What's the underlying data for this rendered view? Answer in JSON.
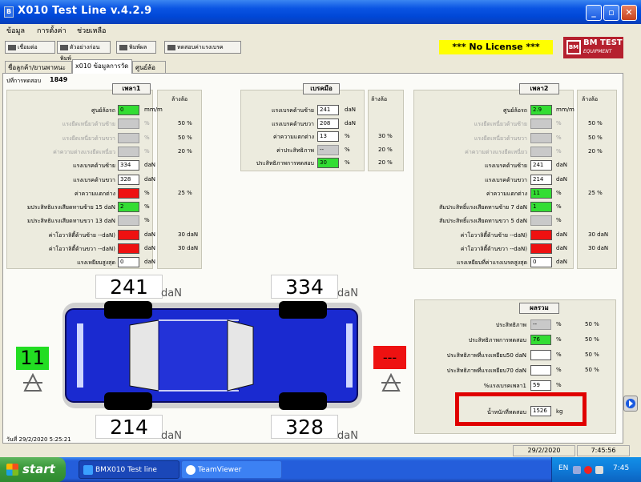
{
  "window": {
    "title": "X010 Test Line v.4.2.9",
    "app_icon": "B"
  },
  "menu": [
    "ข้อมูล",
    "การตั้งค่า",
    "ช่วยเหลือ"
  ],
  "toolbar": {
    "btn1": "เชื่อมต่อ",
    "btn2": "ตัวอย่างก่อนพิมพ์",
    "btn3": "พิมพ์ผล",
    "btn4": "ทดสอบค่าแรงเบรค"
  },
  "license": "***   No License ***",
  "logo": {
    "line1": "BM TEST",
    "line2": "EQUIPMENT",
    "mark": "BM"
  },
  "tabs": [
    "ชื่อลูกค้า/ยานพาหนะ",
    "x010 ข้อมูลการวัด",
    "ศูนย์ล้อรถ"
  ],
  "test_no": {
    "label": "ปที่การทดสอบ",
    "value": "1849"
  },
  "axle1": {
    "title": "เพลา1",
    "side": "ล้างล้อ",
    "rows": [
      {
        "label": "ศูนย์ล้อรถ",
        "value": "0",
        "unit": "mm/m",
        "style": "green",
        "dim": false,
        "extra": ""
      },
      {
        "label": "แรงยืดเหนี่ยวด้านซ้าย",
        "value": "",
        "unit": "%",
        "style": "gray",
        "dim": true,
        "extra": "50 %"
      },
      {
        "label": "แรงยืดเหนี่ยวด้านขวา",
        "value": "",
        "unit": "%",
        "style": "gray",
        "dim": true,
        "extra": "50 %"
      },
      {
        "label": "ค่าความต่างแรงยืดเหนี่ยว",
        "value": "",
        "unit": "%",
        "style": "gray",
        "dim": true,
        "extra": "20 %"
      },
      {
        "label": "แรงเบรคด้านซ้าย",
        "value": "334",
        "unit": "daN",
        "style": "white",
        "dim": false,
        "extra": ""
      },
      {
        "label": "แรงเบรคด้านขวา",
        "value": "328",
        "unit": "daN",
        "style": "white",
        "dim": false,
        "extra": ""
      },
      {
        "label": "ค่าความแตกต่าง",
        "value": "",
        "unit": "%",
        "style": "red",
        "dim": false,
        "extra": "25 %"
      },
      {
        "label": "มประสิทธิแรงเสียดทานซ้าย   15 daN",
        "value": "2",
        "unit": "%",
        "style": "green",
        "dim": false,
        "extra": ""
      },
      {
        "label": "มประสิทธิแรงเสียดทานขวา   13 daN",
        "value": "",
        "unit": "%",
        "style": "gray",
        "dim": false,
        "extra": ""
      },
      {
        "label": "ค่าโอวาลิตี้ด้านซ้าย     --daN)",
        "value": "",
        "unit": "daN",
        "style": "red",
        "dim": false,
        "extra": "30 daN"
      },
      {
        "label": "ค่าโอวาลิตี้ด้านขวา     --daN)",
        "value": "",
        "unit": "daN",
        "style": "red",
        "dim": false,
        "extra": "30 daN"
      },
      {
        "label": "แรงเหยียบสูงสุด",
        "value": "0",
        "unit": "daN",
        "style": "white",
        "dim": false,
        "extra": ""
      }
    ]
  },
  "handbrake": {
    "title": "เบรคมือ",
    "side": "ล้างล้อ",
    "rows": [
      {
        "label": "แรงเบรคด้านซ้าย",
        "value": "241",
        "unit": "daN",
        "style": "white",
        "extra": ""
      },
      {
        "label": "แรงเบรคด้านขวา",
        "value": "208",
        "unit": "daN",
        "style": "white",
        "extra": ""
      },
      {
        "label": "ค่าความแตกต่าง",
        "value": "13",
        "unit": "%",
        "style": "white",
        "extra": "30 %"
      },
      {
        "label": "ค่าประสิทธิภาพ",
        "value": "--",
        "unit": "%",
        "style": "gray",
        "extra": "20 %"
      },
      {
        "label": "ประสิทธิภาพการทดสอบ",
        "value": "30",
        "unit": "%",
        "style": "green",
        "extra": "20 %"
      }
    ]
  },
  "axle2": {
    "title": "เพลา2",
    "side": "ล้างล้อ",
    "rows": [
      {
        "label": "ศูนย์ล้อรถ",
        "value": "2.9",
        "unit": "mm/m",
        "style": "green",
        "dim": false,
        "extra": ""
      },
      {
        "label": "แรงยืดเหนี่ยวด้านซ้าย",
        "value": "",
        "unit": "%",
        "style": "gray",
        "dim": true,
        "extra": "50 %"
      },
      {
        "label": "แรงยืดเหนี่ยวด้านขวา",
        "value": "",
        "unit": "%",
        "style": "gray",
        "dim": true,
        "extra": "50 %"
      },
      {
        "label": "ค่าความต่างแรงยืดเหนี่ยว",
        "value": "",
        "unit": "%",
        "style": "gray",
        "dim": true,
        "extra": "20 %"
      },
      {
        "label": "แรงเบรคด้านซ้าย",
        "value": "241",
        "unit": "daN",
        "style": "white",
        "dim": false,
        "extra": ""
      },
      {
        "label": "แรงเบรคด้านขวา",
        "value": "214",
        "unit": "daN",
        "style": "white",
        "dim": false,
        "extra": ""
      },
      {
        "label": "ค่าความแตกต่าง",
        "value": "11",
        "unit": "%",
        "style": "green",
        "dim": false,
        "extra": "25 %"
      },
      {
        "label": "สัมประสิทธิ์แรงเสียดทานซ้าย     7 daN",
        "value": "1",
        "unit": "%",
        "style": "green",
        "dim": false,
        "extra": ""
      },
      {
        "label": "สัมประสิทธิ์แรงเสียดทานขวา     5 daN",
        "value": "",
        "unit": "%",
        "style": "gray",
        "dim": false,
        "extra": ""
      },
      {
        "label": "ค่าโอวาลิตี้ด้านซ้าย     --daN)",
        "value": "",
        "unit": "daN",
        "style": "red",
        "dim": false,
        "extra": "30 daN"
      },
      {
        "label": "ค่าโอวาลิตี้ด้านขวา     --daN)",
        "value": "",
        "unit": "daN",
        "style": "red",
        "dim": false,
        "extra": "30 daN"
      },
      {
        "label": "แรงเหยียบที่ค่าแรงเบรคสูงสุด",
        "value": "0",
        "unit": "daN",
        "style": "white",
        "dim": false,
        "extra": ""
      }
    ]
  },
  "car": {
    "front_left": "241",
    "front_right": "334",
    "rear_left": "214",
    "rear_right": "328",
    "unit": "daN",
    "left_indicator": "11",
    "right_indicator": "---"
  },
  "summary": {
    "title": "ผลรวม",
    "rows": [
      {
        "label": "ประสิทธิภาพ",
        "value": "--",
        "unit": "%",
        "style": "gray",
        "extra": "50 %"
      },
      {
        "label": "ประสิทธิภาพการทดสอบ",
        "value": "76",
        "unit": "%",
        "style": "green",
        "extra": "50 %"
      },
      {
        "label": "ประสิทธิภาพที่แรงเหยียบ50 daN",
        "value": "",
        "unit": "%",
        "style": "white",
        "extra": "50 %"
      },
      {
        "label": "ประสิทธิภาพที่แรงเหยียบ70 daN",
        "value": "",
        "unit": "%",
        "style": "white",
        "extra": "50 %"
      },
      {
        "label": "%แรงเบรคเพลา1",
        "value": "59",
        "unit": "%",
        "style": "white",
        "extra": ""
      }
    ],
    "weight_label": "น้ำหนักที่ทดสอบ",
    "weight_value": "1526",
    "weight_unit": "kg"
  },
  "date_label": "วันที่ 29/2/2020 5:25:21",
  "status": {
    "date": "29/2/2020",
    "time": "7:45:56"
  },
  "taskbar": {
    "start": "start",
    "task1": "BMX010 Test line",
    "task2": "TeamViewer",
    "lang": "EN",
    "clock": "7:45"
  }
}
